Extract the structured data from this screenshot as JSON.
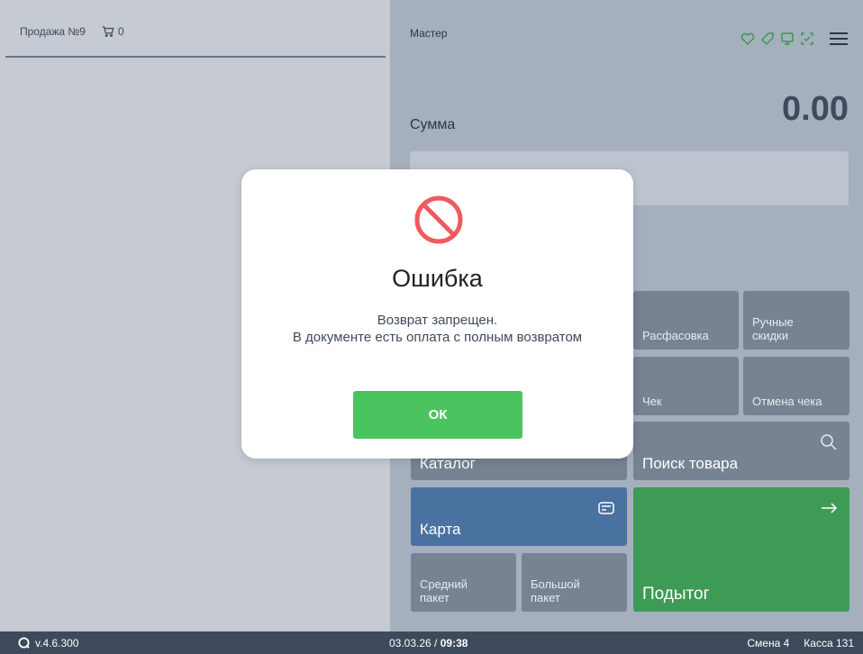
{
  "left": {
    "sale_title": "Продажа №9",
    "cart_count": "0"
  },
  "header": {
    "mode": "Мастер",
    "icons": [
      "heart-icon",
      "tag-icon",
      "monitor-icon",
      "scan-icon",
      "menu-icon"
    ]
  },
  "sum": {
    "label": "Сумма",
    "value": "0.00"
  },
  "tiles": {
    "rasfasovka": "Расфасовка",
    "manual_discounts": "Ручные скидки",
    "check": "Чек",
    "cancel_check": "Отмена чека",
    "catalog": "Каталог",
    "search": "Поиск товара",
    "card": "Карта",
    "medium_bag": "Средний пакет",
    "large_bag": "Большой пакет",
    "subtotal": "Подытог"
  },
  "dialog": {
    "title": "Ошибка",
    "message_line1": "Возврат запрещен.",
    "message_line2": "В документе есть оплата с полным возвратом",
    "ok": "ОК"
  },
  "footer": {
    "version": "v.4.6.300",
    "date": "03.03.26 / ",
    "time": "09:38",
    "shift": "Смена 4",
    "register": "Касса 131"
  },
  "colors": {
    "accent_green": "#4bc45f",
    "subtotal_green": "#3e9b56",
    "card_blue": "#4a72a0",
    "error_red": "#ef5a5f"
  }
}
